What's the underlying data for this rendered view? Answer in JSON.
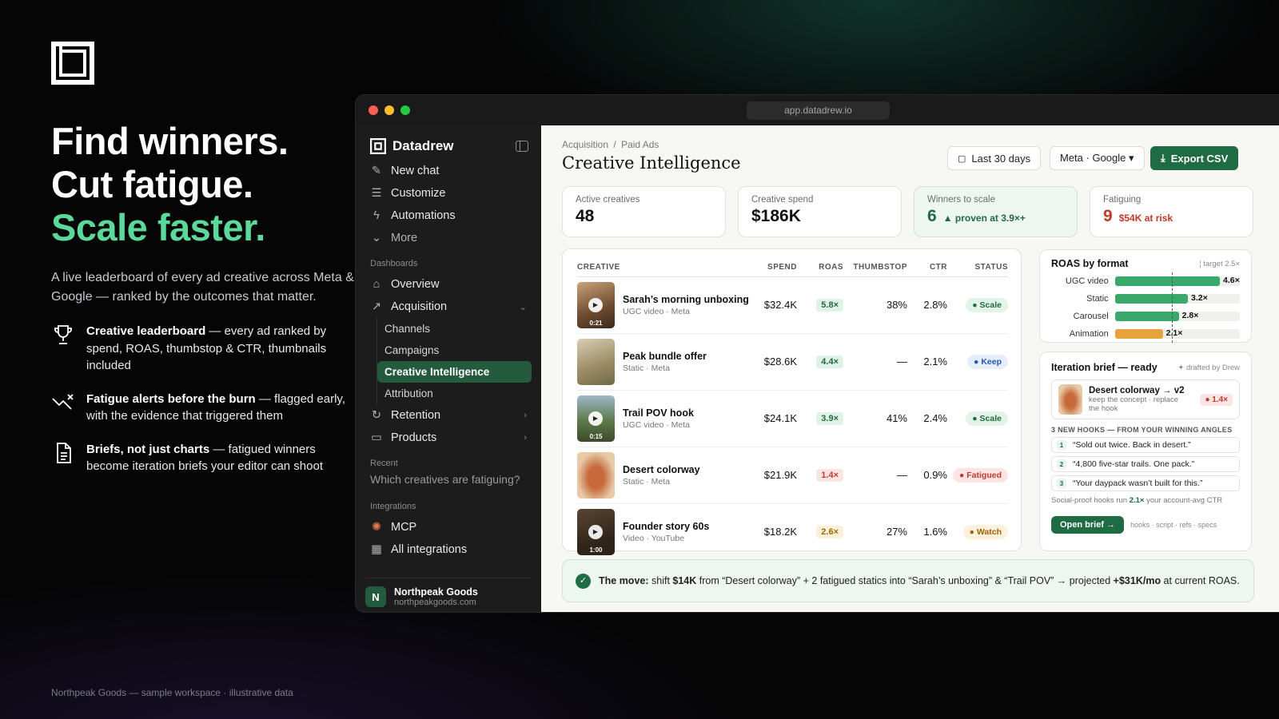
{
  "hero": {
    "line1": "Find winners.",
    "line2": "Cut fatigue.",
    "line3": "Scale faster.",
    "subtitle": "A live leaderboard of every ad creative across Meta & Google — ranked by the outcomes that matter.",
    "features": [
      {
        "icon": "trophy-icon",
        "title": "Creative leaderboard",
        "text": " — every ad ranked by spend, ROAS, thumbstop & CTR, thumbnails included"
      },
      {
        "icon": "trend-down-icon",
        "title": "Fatigue alerts before the burn",
        "text": " — flagged early, with the evidence that triggered them"
      },
      {
        "icon": "document-icon",
        "title": "Briefs, not just charts",
        "text": " — fatigued winners become iteration briefs your editor can shoot"
      }
    ],
    "footnote": "Northpeak Goods — sample workspace · illustrative data"
  },
  "window": {
    "url": "app.datadrew.io"
  },
  "sidebar": {
    "brand": "Datadrew",
    "top": [
      {
        "label": "New chat",
        "icon": "edit-icon"
      },
      {
        "label": "Customize",
        "icon": "sliders-icon"
      },
      {
        "label": "Automations",
        "icon": "bolt-icon"
      },
      {
        "label": "More",
        "icon": "chevron-down-icon"
      }
    ],
    "dashboards_label": "Dashboards",
    "overview": "Overview",
    "acquisition": "Acquisition",
    "acq_children": [
      "Channels",
      "Campaigns",
      "Creative Intelligence",
      "Attribution"
    ],
    "retention": "Retention",
    "products": "Products",
    "recent_label": "Recent",
    "recent_item": "Which creatives are fatiguing?",
    "integrations_label": "Integrations",
    "mcp": "MCP",
    "all_integrations": "All integrations",
    "account": {
      "initial": "N",
      "name": "Northpeak Goods",
      "url": "northpeakgoods.com"
    }
  },
  "main": {
    "breadcrumb_1": "Acquisition",
    "breadcrumb_sep": "/",
    "breadcrumb_2": "Paid Ads",
    "title": "Creative Intelligence",
    "date_range": "Last 30 days",
    "platforms": "Meta · Google ▾",
    "export": "Export CSV",
    "stats": [
      {
        "label": "Active creatives",
        "value": "48",
        "note": ""
      },
      {
        "label": "Creative spend",
        "value": "$186K",
        "note": ""
      },
      {
        "label": "Winners to scale",
        "value": "6",
        "note": "▲ proven at 3.9×+"
      },
      {
        "label": "Fatiguing",
        "value": "9",
        "note": "$54K at risk"
      }
    ],
    "table": {
      "headers": [
        "CREATIVE",
        "SPEND",
        "ROAS",
        "THUMBSTOP",
        "CTR",
        "STATUS"
      ],
      "rows": [
        {
          "name": "Sarah’s morning unboxing",
          "meta": "UGC video · Meta",
          "duration": "0:21",
          "spend": "$32.4K",
          "roas": "5.8×",
          "thumbstop": "38%",
          "ctr": "2.8%",
          "status": "Scale"
        },
        {
          "name": "Peak bundle offer",
          "meta": "Static · Meta",
          "duration": "",
          "spend": "$28.6K",
          "roas": "4.4×",
          "thumbstop": "—",
          "ctr": "2.1%",
          "status": "Keep"
        },
        {
          "name": "Trail POV hook",
          "meta": "UGC video · Meta",
          "duration": "0:15",
          "spend": "$24.1K",
          "roas": "3.9×",
          "thumbstop": "41%",
          "ctr": "2.4%",
          "status": "Scale"
        },
        {
          "name": "Desert colorway",
          "meta": "Static · Meta",
          "duration": "",
          "spend": "$21.9K",
          "roas": "1.4×",
          "thumbstop": "—",
          "ctr": "0.9%",
          "status": "Fatigued"
        },
        {
          "name": "Founder story 60s",
          "meta": "Video · YouTube",
          "duration": "1:00",
          "spend": "$18.2K",
          "roas": "2.6×",
          "thumbstop": "27%",
          "ctr": "1.6%",
          "status": "Watch"
        }
      ]
    },
    "roas_card": {
      "title": "ROAS by format",
      "target": "target 2.5×",
      "target_value": 2.5,
      "max": 5.5,
      "bars": [
        {
          "label": "UGC video",
          "value": 4.6,
          "text": "4.6×",
          "color": "#3aa86b"
        },
        {
          "label": "Static",
          "value": 3.2,
          "text": "3.2×",
          "color": "#3aa86b"
        },
        {
          "label": "Carousel",
          "value": 2.8,
          "text": "2.8×",
          "color": "#3aa86b"
        },
        {
          "label": "Animation",
          "value": 2.1,
          "text": "2.1×",
          "color": "#e6a23c"
        }
      ]
    },
    "brief": {
      "title": "Iteration brief — ready",
      "drafted": "✦ drafted by Drew",
      "item_title": "Desert colorway → v2",
      "item_desc": "keep the concept · replace the hook",
      "item_roas": "● 1.4×",
      "hooks_label": "3 NEW HOOKS — FROM YOUR WINNING ANGLES",
      "hooks": [
        "“Sold out twice. Back in desert.”",
        "“4,800 five-star trails. One pack.”",
        "“Your daypack wasn’t built for this.”"
      ],
      "insight_pre": "Social-proof hooks run ",
      "insight_val": "2.1×",
      "insight_post": " your account-avg CTR",
      "open": "Open brief →",
      "tags": "hooks · script · refs · specs"
    },
    "move": {
      "label": "The move:",
      "t1": " shift ",
      "amt": "$14K",
      "t2": " from “Desert colorway” + 2 fatigued statics into “Sarah’s unboxing” & “Trail POV” → projected ",
      "proj": "+$31K/mo",
      "t3": " at current ROAS."
    }
  }
}
